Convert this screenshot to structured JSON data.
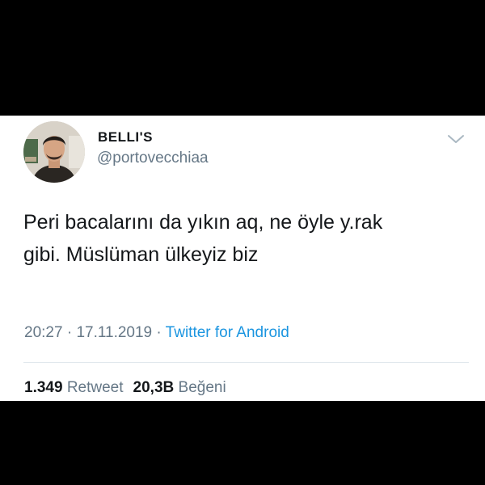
{
  "tweet": {
    "display_name": "BELLI'S",
    "handle": "@portovecchiaa",
    "text_lines": [
      "Peri bacalarını da yıkın aq, ne öyle y.rak",
      "gibi. Müslüman ülkeyiz biz"
    ],
    "time": "20:27",
    "date": "17.11.2019",
    "separator": " · ",
    "source": "Twitter for Android",
    "retweets": {
      "count": "1.349",
      "label": "Retweet"
    },
    "likes": {
      "count": "20,3B",
      "label": "Beğeni"
    },
    "menu_icon": "chevron-down-icon"
  },
  "colors": {
    "text_primary": "#14171a",
    "text_secondary": "#657786",
    "link": "#1b95e0",
    "background": "#000000",
    "card": "#ffffff"
  }
}
